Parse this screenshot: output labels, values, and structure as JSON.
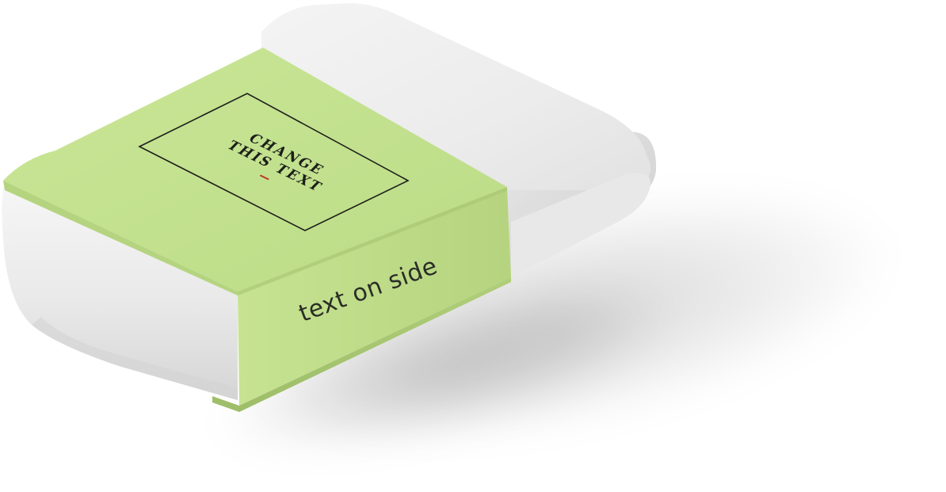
{
  "mockup": {
    "front_text": {
      "line1": "CHANGE",
      "line2": "THIS TEXT"
    },
    "side_text": "text on side",
    "colors": {
      "background": "#ffffff",
      "eraser": "#f1f1f1",
      "sleeve": "#c4e291",
      "accent": "#c0392b",
      "ink": "#1d1f1a"
    }
  }
}
